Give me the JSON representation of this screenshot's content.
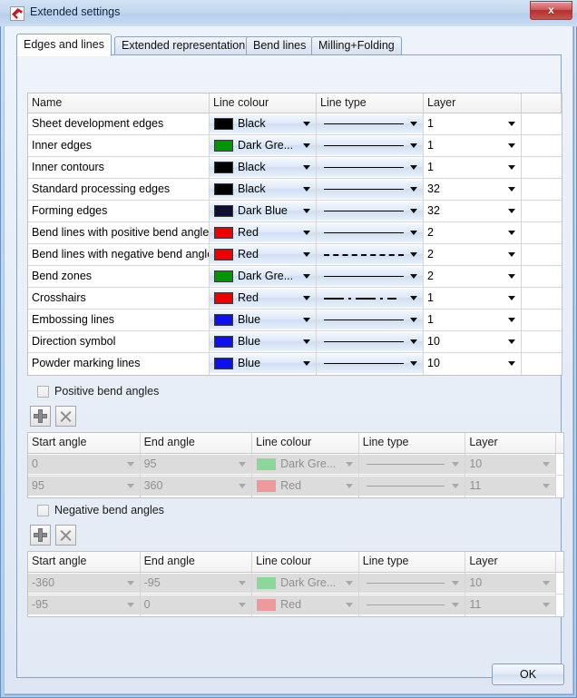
{
  "window": {
    "title": "Extended settings",
    "icon": "app-icon",
    "close_label": "x"
  },
  "tabs": [
    {
      "label": "Edges and lines",
      "active": true
    },
    {
      "label": "Extended representation",
      "active": false
    },
    {
      "label": "Bend lines",
      "active": false
    },
    {
      "label": "Milling+Folding",
      "active": false
    }
  ],
  "main_grid": {
    "headers": [
      "Name",
      "Line colour",
      "Line type",
      "Layer",
      ""
    ],
    "rows": [
      {
        "name": "Sheet development edges",
        "colour": "Black",
        "colour_hex": "#000000",
        "line_type": "solid",
        "layer": "1"
      },
      {
        "name": "Inner edges",
        "colour": "Dark Gre...",
        "colour_hex": "#009600",
        "line_type": "solid",
        "layer": "1"
      },
      {
        "name": "Inner contours",
        "colour": "Black",
        "colour_hex": "#000000",
        "line_type": "solid",
        "layer": "1"
      },
      {
        "name": "Standard processing edges",
        "colour": "Black",
        "colour_hex": "#000000",
        "line_type": "solid",
        "layer": "32"
      },
      {
        "name": "Forming edges",
        "colour": "Dark Blue",
        "colour_hex": "#0d0d34",
        "line_type": "solid",
        "layer": "32"
      },
      {
        "name": "Bend lines with positive bend angle",
        "colour": "Red",
        "colour_hex": "#ee0000",
        "line_type": "solid",
        "layer": "2"
      },
      {
        "name": "Bend lines with negative bend angle",
        "colour": "Red",
        "colour_hex": "#ee0000",
        "line_type": "dashed",
        "layer": "2"
      },
      {
        "name": "Bend zones",
        "colour": "Dark Gre...",
        "colour_hex": "#009600",
        "line_type": "solid",
        "layer": "2"
      },
      {
        "name": "Crosshairs",
        "colour": "Red",
        "colour_hex": "#ee0000",
        "line_type": "dashdot",
        "layer": "1"
      },
      {
        "name": "Embossing lines",
        "colour": "Blue",
        "colour_hex": "#1010ee",
        "line_type": "solid",
        "layer": "1"
      },
      {
        "name": "Direction symbol",
        "colour": "Blue",
        "colour_hex": "#1010ee",
        "line_type": "solid",
        "layer": "10"
      },
      {
        "name": "Powder marking lines",
        "colour": "Blue",
        "colour_hex": "#1010ee",
        "line_type": "solid",
        "layer": "10"
      }
    ]
  },
  "positive_section": {
    "checkbox_label": "Positive bend angles",
    "checked": false,
    "add_button": "add-row",
    "delete_button": "delete-row",
    "headers": [
      "Start angle",
      "End angle",
      "Line colour",
      "Line type",
      "Layer",
      ""
    ],
    "rows": [
      {
        "start": "0",
        "end": "95",
        "colour": "Dark Gre...",
        "colour_hex": "#8ed79a",
        "line_type": "solid",
        "layer": "10"
      },
      {
        "start": "95",
        "end": "360",
        "colour": "Red",
        "colour_hex": "#ef9a9a",
        "line_type": "solid",
        "layer": "11"
      }
    ]
  },
  "negative_section": {
    "checkbox_label": "Negative bend angles",
    "checked": false,
    "add_button": "add-row",
    "delete_button": "delete-row",
    "headers": [
      "Start angle",
      "End angle",
      "Line colour",
      "Line type",
      "Layer",
      ""
    ],
    "rows": [
      {
        "start": "-360",
        "end": "-95",
        "colour": "Dark Gre...",
        "colour_hex": "#8ed79a",
        "line_type": "solid",
        "layer": "10"
      },
      {
        "start": "-95",
        "end": "0",
        "colour": "Red",
        "colour_hex": "#ef9a9a",
        "line_type": "solid",
        "layer": "11"
      }
    ]
  },
  "footer": {
    "ok_label": "OK"
  },
  "colors": {
    "titlebar": "#c3d7ef",
    "close": "#b52e2e",
    "panel": "#e7edf7",
    "grid_bg": "#ffffff",
    "disabled": "#dcdcdc"
  }
}
